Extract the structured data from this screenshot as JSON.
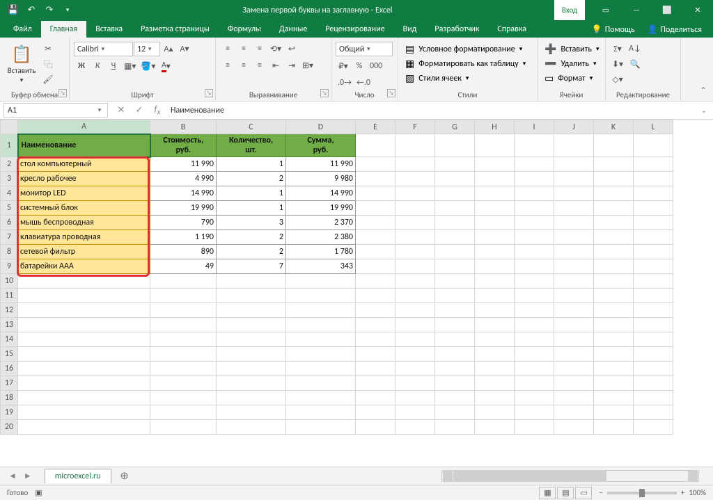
{
  "app": {
    "title": "Замена первой буквы на заглавную  -  Excel",
    "login": "Вход"
  },
  "qat": [
    "💾",
    "↶",
    "↷"
  ],
  "win": [
    "▭",
    "—",
    "⬜",
    "✕"
  ],
  "tabs": [
    "Файл",
    "Главная",
    "Вставка",
    "Разметка страницы",
    "Формулы",
    "Данные",
    "Рецензирование",
    "Вид",
    "Разработчик",
    "Справка"
  ],
  "tell": {
    "icon": "💡",
    "label": "Помощь"
  },
  "share": {
    "icon": "👤",
    "label": "Поделиться"
  },
  "ribbon": {
    "clipboard": {
      "paste": "Вставить",
      "label": "Буфер обмена"
    },
    "font": {
      "name": "Calibri",
      "size": "12",
      "b": "Ж",
      "i": "К",
      "u": "Ч",
      "label": "Шрифт"
    },
    "align": {
      "label": "Выравнивание"
    },
    "number": {
      "fmt": "Общий",
      "label": "Число"
    },
    "styles": {
      "cond": "Условное форматирование",
      "table": "Форматировать как таблицу",
      "cell": "Стили ячеек",
      "label": "Стили"
    },
    "cells": {
      "ins": "Вставить",
      "del": "Удалить",
      "fmt": "Формат",
      "label": "Ячейки"
    },
    "editing": {
      "label": "Редактирование"
    }
  },
  "namebox": "A1",
  "formula": "Наименование",
  "cols": [
    "A",
    "B",
    "C",
    "D",
    "E",
    "F",
    "G",
    "H",
    "I",
    "J",
    "K",
    "L"
  ],
  "headers": [
    "Наименование",
    "Стоимость, руб.",
    "Количество, шт.",
    "Сумма, руб."
  ],
  "rows": [
    {
      "n": "стол компьютерный",
      "c": "11 990",
      "q": "1",
      "s": "11 990"
    },
    {
      "n": "кресло рабочее",
      "c": "4 990",
      "q": "2",
      "s": "9 980"
    },
    {
      "n": "монитор LED",
      "c": "14 990",
      "q": "1",
      "s": "14 990"
    },
    {
      "n": "системный блок",
      "c": "19 990",
      "q": "1",
      "s": "19 990"
    },
    {
      "n": "мышь беспроводная",
      "c": "790",
      "q": "3",
      "s": "2 370"
    },
    {
      "n": "клавиатура проводная",
      "c": "1 190",
      "q": "2",
      "s": "2 380"
    },
    {
      "n": "сетевой фильтр",
      "c": "890",
      "q": "2",
      "s": "1 780"
    },
    {
      "n": "батарейки AAA",
      "c": "49",
      "q": "7",
      "s": "343"
    }
  ],
  "sheet": "microexcel.ru",
  "status": {
    "ready": "Готово",
    "zoom": "100%"
  }
}
